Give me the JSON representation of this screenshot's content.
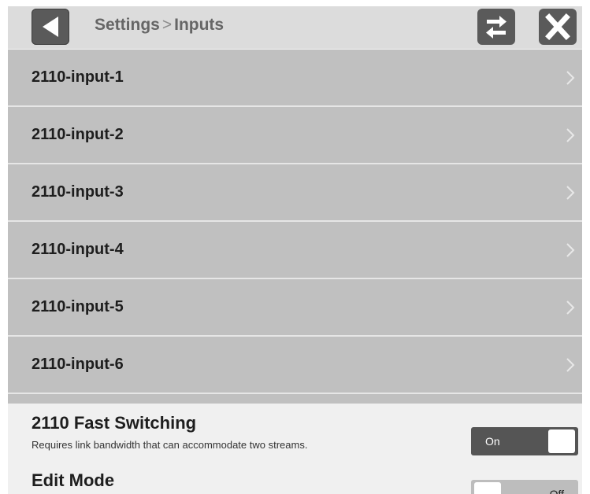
{
  "header": {
    "breadcrumb_root": "Settings",
    "breadcrumb_separator": ">",
    "breadcrumb_current": "Inputs",
    "back_icon": "back-arrow-icon",
    "swap_icon": "swap-arrows-icon",
    "close_icon": "close-x-icon"
  },
  "inputs": [
    {
      "label": "2110-input-1"
    },
    {
      "label": "2110-input-2"
    },
    {
      "label": "2110-input-3"
    },
    {
      "label": "2110-input-4"
    },
    {
      "label": "2110-input-5"
    },
    {
      "label": "2110-input-6"
    }
  ],
  "fast_switching": {
    "title": "2110 Fast Switching",
    "description": "Requires link bandwidth that can accommodate two streams.",
    "state": "On"
  },
  "edit_mode": {
    "title": "Edit Mode",
    "state": "Off"
  },
  "colors": {
    "button_dark": "#5a5a5a",
    "row_background": "#c0c0c0",
    "header_background": "#dcdcdc",
    "toggle_on": "#555555"
  }
}
